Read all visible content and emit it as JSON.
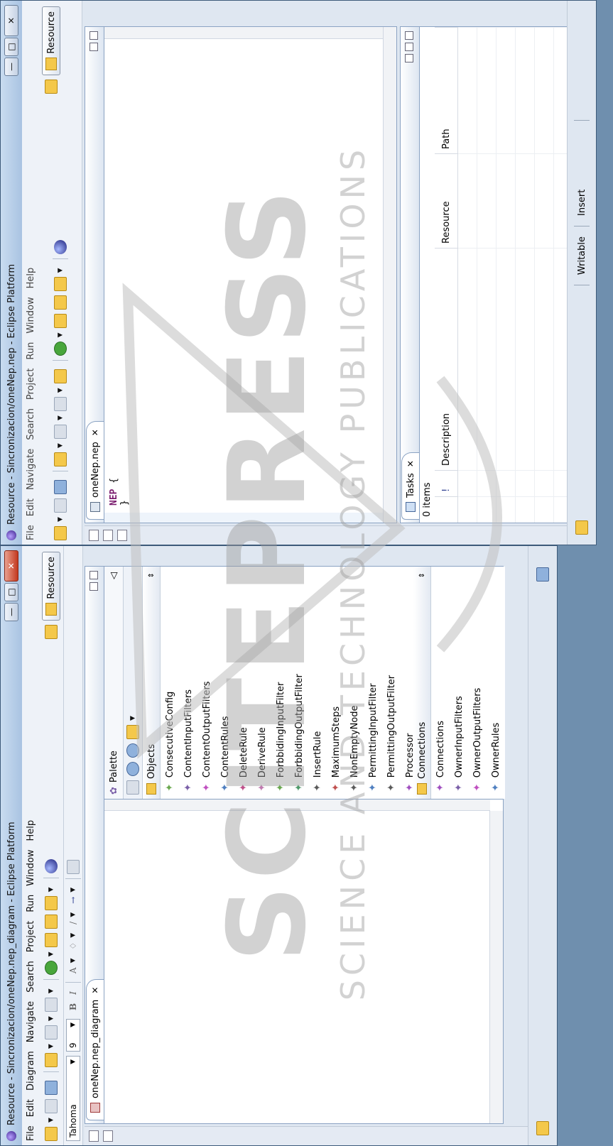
{
  "diagram_window": {
    "title": "Resource - Sincronizacion/oneNep.nep_diagram - Eclipse Platform",
    "menu": [
      "File",
      "Edit",
      "Diagram",
      "Navigate",
      "Search",
      "Project",
      "Run",
      "Window",
      "Help"
    ],
    "perspective_label": "Resource",
    "font_name": "Tahoma",
    "font_size": "9",
    "editor_tab": "oneNep.nep_diagram",
    "palette": {
      "title": "Palette",
      "objects_label": "Objects",
      "objects": [
        {
          "label": "ConsecutiveConfig",
          "color": "#6aa84f"
        },
        {
          "label": "ContentInputFilters",
          "color": "#7a5fa8"
        },
        {
          "label": "ContentOutputFilters",
          "color": "#c04fc0"
        },
        {
          "label": "ContentRules",
          "color": "#4f7fc0"
        },
        {
          "label": "DeleteRule",
          "color": "#c04f8a"
        },
        {
          "label": "DeriveRule",
          "color": "#c07ab0"
        },
        {
          "label": "ForbbidingInputFilter",
          "color": "#6aa84f"
        },
        {
          "label": "ForbbidingOutputFilter",
          "color": "#4f9a6a"
        },
        {
          "label": "InsertRule",
          "color": "#5a5a5a"
        },
        {
          "label": "MaximumSteps",
          "color": "#c0504f"
        },
        {
          "label": "NonEmptyNode",
          "color": "#5a5a5a"
        },
        {
          "label": "PermittingInputFilter",
          "color": "#4f7fc0"
        },
        {
          "label": "PermittingOutputFilter",
          "color": "#5a5a5a"
        },
        {
          "label": "Processor",
          "color": "#a04fc0"
        }
      ],
      "connections_label": "Connections",
      "connections": [
        {
          "label": "Connections",
          "color": "#a04fc0"
        },
        {
          "label": "OwnerInputFilters",
          "color": "#7a5fa8"
        },
        {
          "label": "OwnerOutputFilters",
          "color": "#c04fc0"
        },
        {
          "label": "OwnerRules",
          "color": "#4f7fc0"
        }
      ]
    }
  },
  "text_window": {
    "title": "Resource - Sincronizacion/oneNep.nep - Eclipse Platform",
    "menu": [
      "File",
      "Edit",
      "Navigate",
      "Search",
      "Project",
      "Run",
      "Window",
      "Help"
    ],
    "perspective_label": "Resource",
    "editor_tab": "oneNep.nep",
    "code_keyword": "NEP",
    "code_open": "{",
    "code_close": "}",
    "tasks": {
      "tab_label": "Tasks",
      "count": "0 items",
      "columns": [
        "!",
        "Description",
        "Resource",
        "Path"
      ]
    },
    "status": {
      "writable": "Writable",
      "insert": "Insert"
    }
  },
  "watermark": {
    "main": "SCITEPRESS",
    "sub": "SCIENCE AND TECHNOLOGY PUBLICATIONS"
  }
}
